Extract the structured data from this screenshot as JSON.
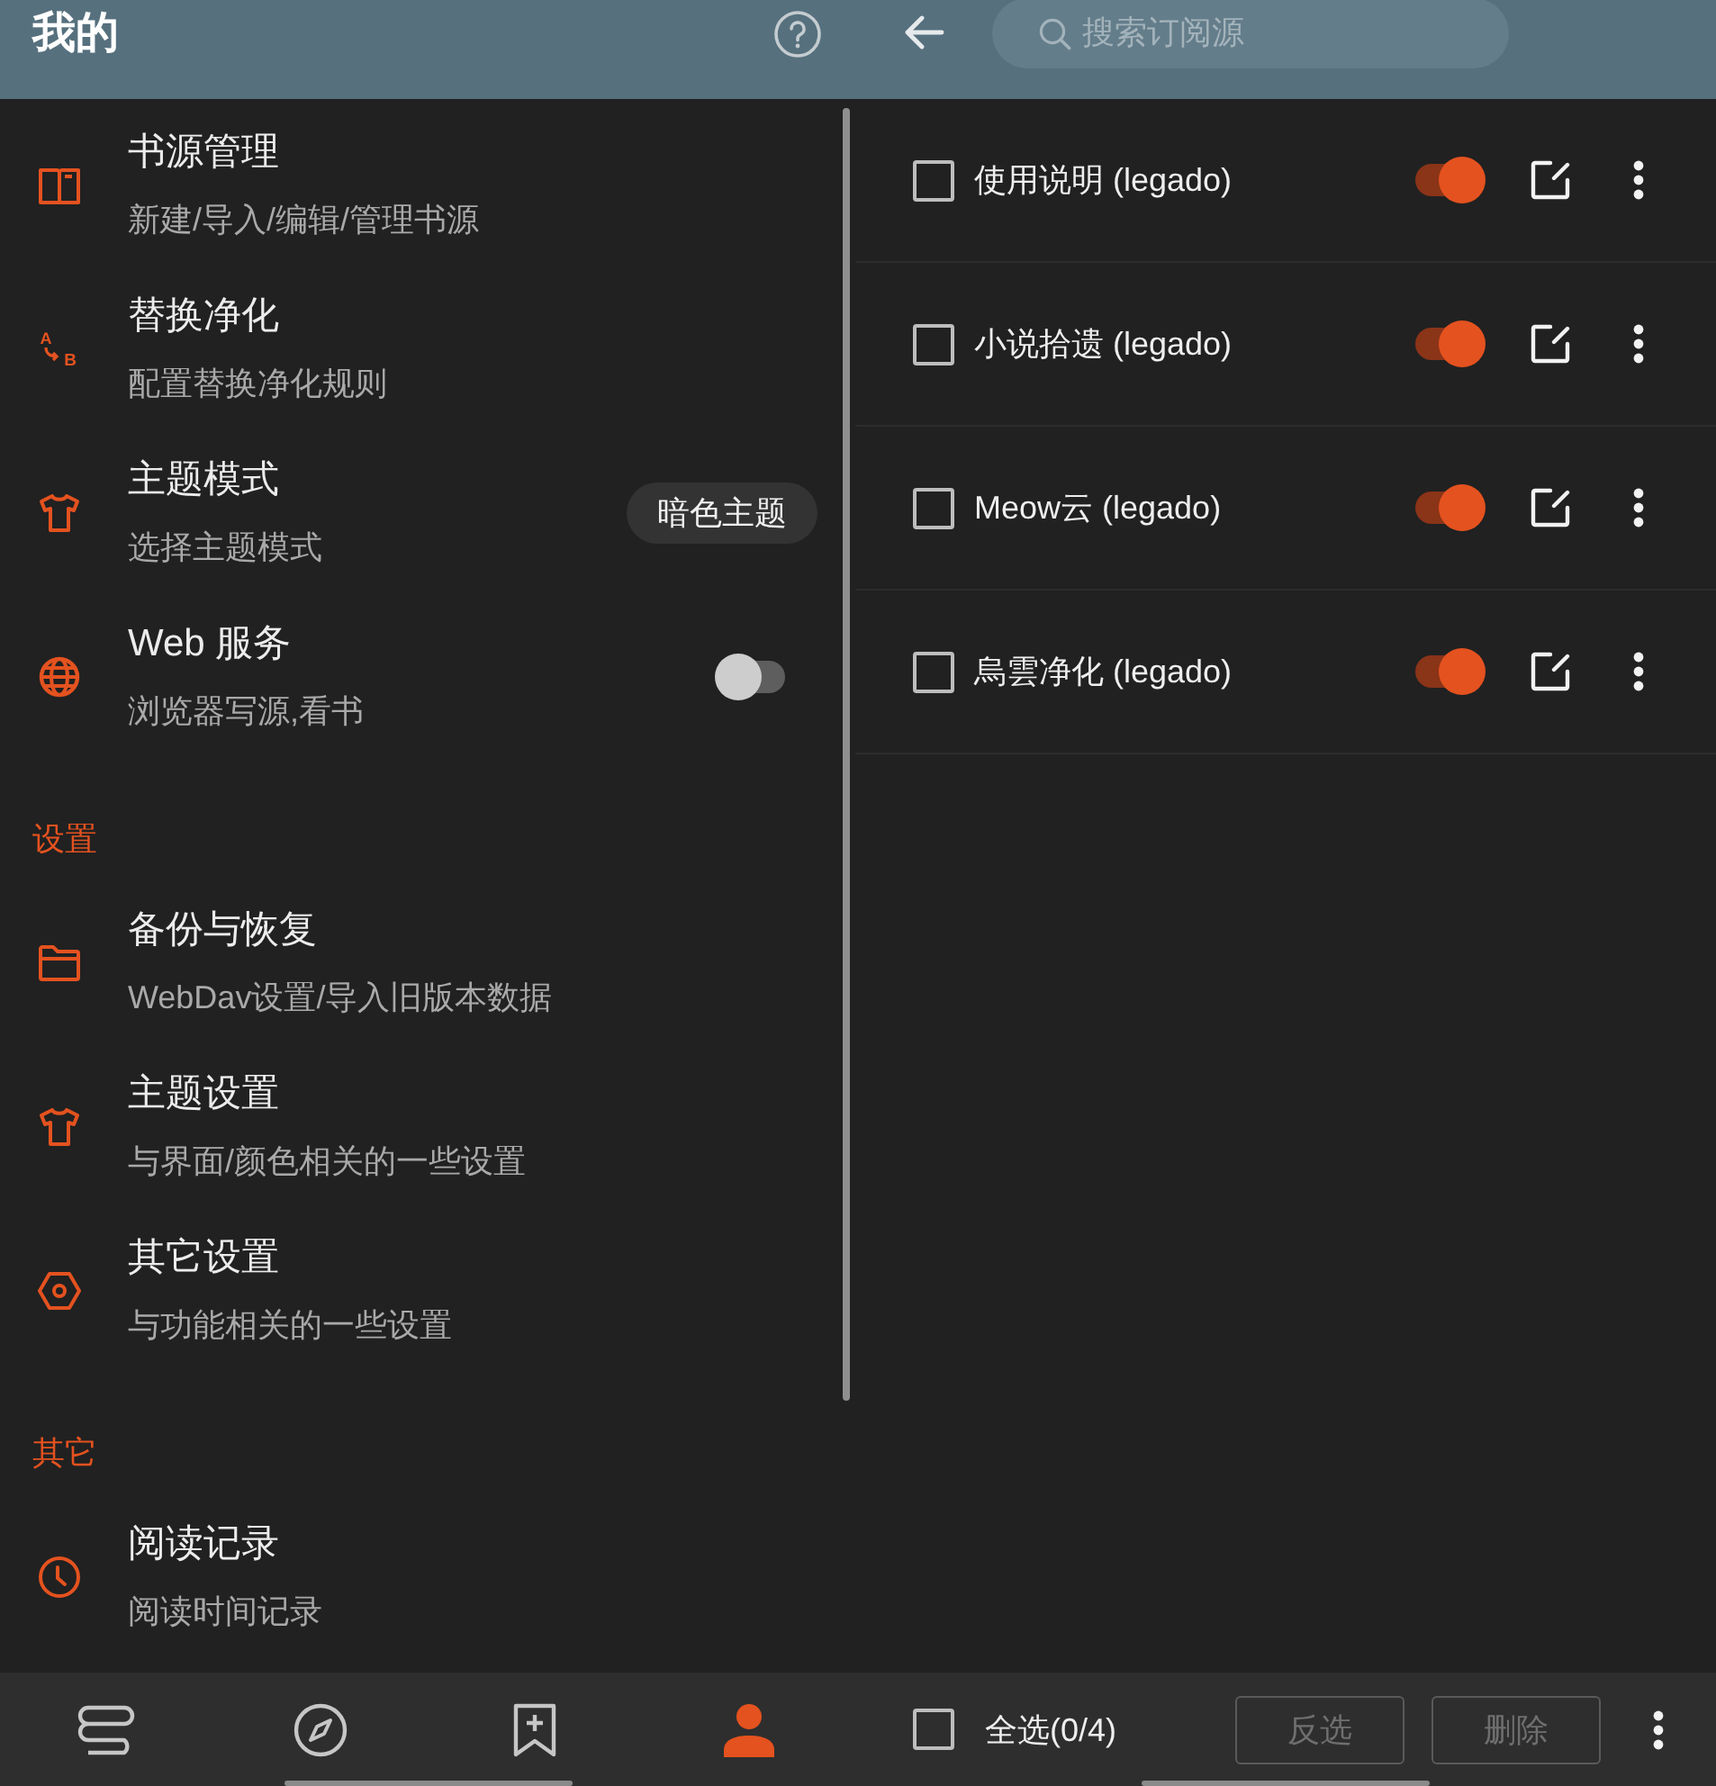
{
  "left": {
    "header": {
      "title": "我的"
    },
    "sections": [
      {
        "items": [
          {
            "title": "书源管理",
            "subtitle": "新建/导入/编辑/管理书源",
            "kind": "plain"
          },
          {
            "title": "替换净化",
            "subtitle": "配置替换净化规则",
            "kind": "plain",
            "icon_letters": [
              "A",
              "B"
            ]
          },
          {
            "title": "主题模式",
            "subtitle": "选择主题模式",
            "kind": "chip",
            "value": "暗色主题"
          },
          {
            "title": "Web 服务",
            "subtitle": "浏览器写源,看书",
            "kind": "switch",
            "on": false
          }
        ]
      },
      {
        "header": "设置",
        "items": [
          {
            "title": "备份与恢复",
            "subtitle": "WebDav设置/导入旧版本数据",
            "kind": "plain"
          },
          {
            "title": "主题设置",
            "subtitle": "与界面/颜色相关的一些设置",
            "kind": "plain"
          },
          {
            "title": "其它设置",
            "subtitle": "与功能相关的一些设置",
            "kind": "plain"
          }
        ]
      },
      {
        "header": "其它",
        "items": [
          {
            "title": "阅读记录",
            "subtitle": "阅读时间记录",
            "kind": "plain"
          }
        ]
      }
    ],
    "bottom_nav": [
      {
        "selected": false
      },
      {
        "selected": false
      },
      {
        "selected": false
      },
      {
        "selected": true
      }
    ]
  },
  "right": {
    "header": {
      "search": {
        "placeholder": "搜索订阅源"
      }
    },
    "rows": [
      {
        "name": "使用说明 (legado)",
        "checked": false,
        "on": true
      },
      {
        "name": "小说拾遗 (legado)",
        "checked": false,
        "on": true
      },
      {
        "name": "Meow云 (legado)",
        "checked": false,
        "on": true
      },
      {
        "name": "烏雲净化 (legado)",
        "checked": false,
        "on": true
      }
    ],
    "footer": {
      "select_all": {
        "label": "全选(0/4)",
        "checked": false
      },
      "buttons": [
        {
          "label": "反选",
          "disabled": true
        },
        {
          "label": "删除",
          "disabled": true
        }
      ]
    }
  }
}
